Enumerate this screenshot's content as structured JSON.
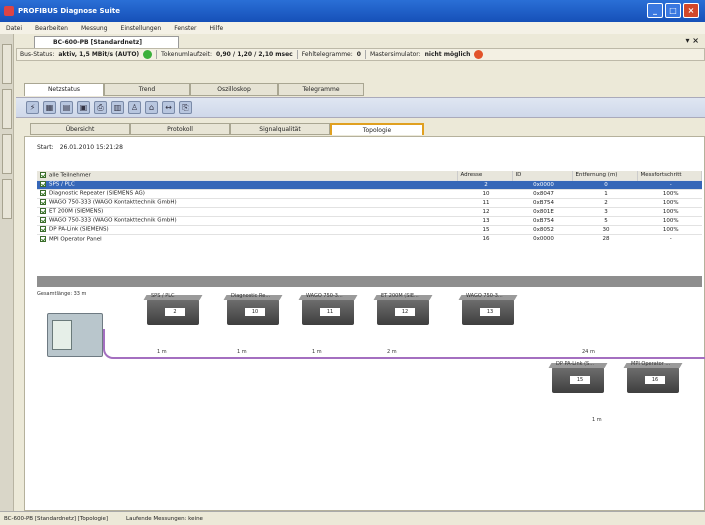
{
  "window": {
    "title": "PROFIBUS Diagnose Suite"
  },
  "menu": [
    "Datei",
    "Bearbeiten",
    "Messung",
    "Einstellungen",
    "Fenster",
    "Hilfe"
  ],
  "document": {
    "tab": "BC-600-PB [Standardnetz]"
  },
  "bus_status": {
    "label": "Bus-Status:",
    "value": "aktiv, 1,5 MBit/s (AUTO)",
    "token_label": "Tokenumlaufzeit:",
    "token_value": "0,90 / 1,20 / 2,10 msec",
    "error_label": "Fehltelegramme:",
    "error_value": "0",
    "master_label": "Mastersimulator:",
    "master_value": "nicht möglich"
  },
  "main_tabs": [
    "Netzstatus",
    "Trend",
    "Oszilloskop",
    "Telegramme"
  ],
  "sub_tabs": [
    "Übersicht",
    "Protokoll",
    "Signalqualität",
    "Topologie"
  ],
  "start": {
    "label": "Start:",
    "value": "26.01.2010 15:21:28"
  },
  "table": {
    "headers": [
      "alle Teilnehmer",
      "Adresse",
      "ID",
      "Entfernung (m)",
      "Messfortschritt"
    ],
    "rows": [
      {
        "name": "SPS / PLC",
        "addr": "2",
        "id": "0x0000",
        "dist": "0",
        "progress": "-",
        "selected": true
      },
      {
        "name": "Diagnostic Repeater (SIEMENS AG)",
        "addr": "10",
        "id": "0x8047",
        "dist": "1",
        "progress": "100%"
      },
      {
        "name": "WAGO 750-333 (WAGO Kontakttechnik GmbH)",
        "addr": "11",
        "id": "0xB754",
        "dist": "2",
        "progress": "100%"
      },
      {
        "name": "ET 200M (SIEMENS)",
        "addr": "12",
        "id": "0x801E",
        "dist": "3",
        "progress": "100%"
      },
      {
        "name": "WAGO 750-333 (WAGO Kontakttechnik GmbH)",
        "addr": "13",
        "id": "0xB754",
        "dist": "5",
        "progress": "100%"
      },
      {
        "name": "DP PA-Link (SIEMENS)",
        "addr": "15",
        "id": "0x8052",
        "dist": "30",
        "progress": "100%"
      },
      {
        "name": "MPI Operator Panel",
        "addr": "16",
        "id": "0x0000",
        "dist": "28",
        "progress": "-"
      }
    ]
  },
  "topology": {
    "total_length": "Gesamtlänge: 33 m",
    "nodes": [
      {
        "label": "SPS / PLC",
        "addr": "2"
      },
      {
        "label": "Diagnostic Re...",
        "addr": "10"
      },
      {
        "label": "WAGO 750-3...",
        "addr": "11"
      },
      {
        "label": "ET 200M (SIE...",
        "addr": "12"
      },
      {
        "label": "WAGO 750-3...",
        "addr": "13"
      },
      {
        "label": "DP PA-Link (S...",
        "addr": "15"
      },
      {
        "label": "MPI Operator ...",
        "addr": "16"
      }
    ],
    "lengths": [
      "1 m",
      "1 m",
      "1 m",
      "2 m",
      "24 m",
      "1 m"
    ]
  },
  "footer": {
    "left": "BC-600-PB [Standardnetz] [Topologie]",
    "right": "Laufende Messungen: keine"
  }
}
